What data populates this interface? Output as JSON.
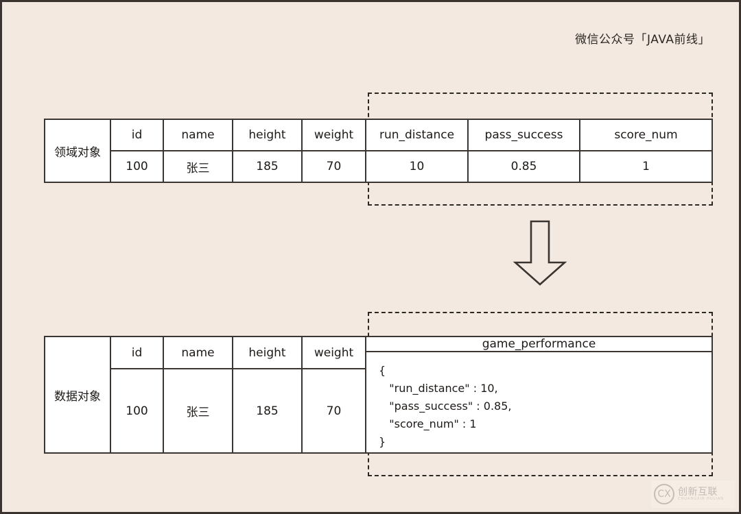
{
  "caption": {
    "text": "微信公众号「JAVA前线」"
  },
  "colors": {
    "background": "#f4e9e0",
    "table_fill": "#ffffff",
    "line": "#3b3532",
    "text": "#1d1a18",
    "dashed": "#2b2723"
  },
  "domain_table": {
    "row_label": "领域对象",
    "headers": [
      "id",
      "name",
      "height",
      "weight",
      "run_distance",
      "pass_success",
      "score_num"
    ],
    "values": [
      "100",
      "张三",
      "185",
      "70",
      "10",
      "0.85",
      "1"
    ],
    "highlight_note": "run_distance / pass_success / score_num columns enclosed in dashed box"
  },
  "data_table": {
    "row_label": "数据对象",
    "headers": [
      "id",
      "name",
      "height",
      "weight",
      "game_performance"
    ],
    "values": [
      "100",
      "张三",
      "185",
      "70"
    ],
    "json_value": "{\n   \"run_distance\" : 10,\n   \"pass_success\" : 0.85,\n   \"score_num\" : 1\n}",
    "highlight_note": "game_performance column enclosed in dashed box"
  },
  "arrow": {
    "direction": "down",
    "name": "transform-arrow"
  },
  "watermark": {
    "mark": "CX",
    "chinese": "创新互联",
    "pinyin": "CHUANGXIN HULIAN"
  }
}
